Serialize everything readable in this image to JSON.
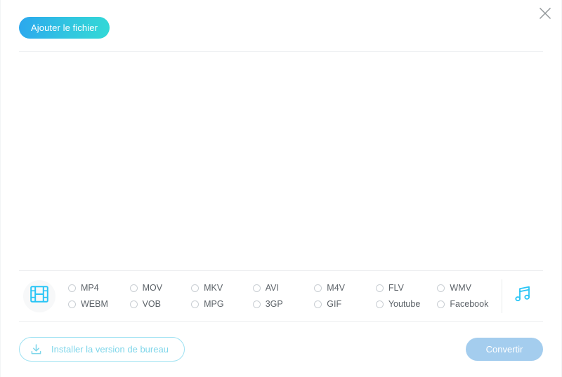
{
  "window": {
    "close_label": "×",
    "close_icon": "close-icon"
  },
  "header": {
    "add_file_label": "Ajouter le fichier"
  },
  "main": {
    "drop_hint": ""
  },
  "format_bar": {
    "video_icon": "film-strip-icon",
    "audio_icon": "music-note-icon",
    "options": [
      {
        "label": "MP4",
        "selected": false
      },
      {
        "label": "MOV",
        "selected": false
      },
      {
        "label": "MKV",
        "selected": false
      },
      {
        "label": "AVI",
        "selected": false
      },
      {
        "label": "M4V",
        "selected": false
      },
      {
        "label": "FLV",
        "selected": false
      },
      {
        "label": "WMV",
        "selected": false
      },
      {
        "label": "WEBM",
        "selected": false
      },
      {
        "label": "VOB",
        "selected": false
      },
      {
        "label": "MPG",
        "selected": false
      },
      {
        "label": "3GP",
        "selected": false
      },
      {
        "label": "GIF",
        "selected": false
      },
      {
        "label": "Youtube",
        "selected": false
      },
      {
        "label": "Facebook",
        "selected": false
      }
    ]
  },
  "footer": {
    "desktop_label": "Installer la version de bureau",
    "desktop_icon": "download-icon",
    "convert_label": "Convertir"
  },
  "colors": {
    "accent_blue": "#2ba7ee",
    "accent_teal": "#32d9d6",
    "cyan_icon": "#29c5f6",
    "convert_disabled": "#a4cdee",
    "text_gray": "#5c6268",
    "border_gray": "#eceef0"
  }
}
